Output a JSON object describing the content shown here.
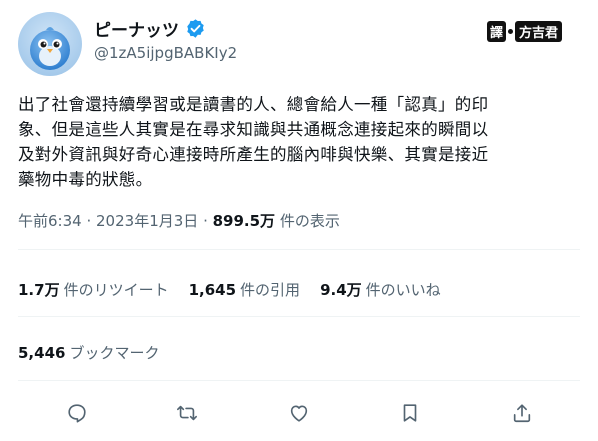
{
  "user": {
    "display_name": "ピーナッツ",
    "handle": "@1zA5ijpgBABKIy2",
    "verified": true,
    "avatar_icon": "blue-bird-avatar"
  },
  "watermark": {
    "label_a": "譯",
    "label_b": "方吉君"
  },
  "tweet": {
    "text": "出了社會還持續學習或是讀書的人、總會給人一種「認真」的印\n象、但是這些人其實是在尋求知識與共通概念連接起來的瞬間以\n及對外資訊與好奇心連接時所產生的腦內啡與快樂、其實是接近\n藥物中毒的狀態。"
  },
  "meta": {
    "time": "午前6:34",
    "date": "2023年1月3日",
    "views_count": "899.5万",
    "views_label": "件の表示"
  },
  "stats": {
    "retweets_count": "1.7万",
    "retweets_label": "件のリツイート",
    "quotes_count": "1,645",
    "quotes_label": "件の引用",
    "likes_count": "9.4万",
    "likes_label": "件のいいね",
    "bookmarks_count": "5,446",
    "bookmarks_label": "ブックマーク"
  },
  "actions": [
    "reply-icon",
    "retweet-icon",
    "like-icon",
    "bookmark-icon",
    "share-icon"
  ],
  "colors": {
    "verified": "#1d9bf0",
    "text": "#0f1419",
    "muted": "#536471",
    "divider": "#eff3f4"
  }
}
